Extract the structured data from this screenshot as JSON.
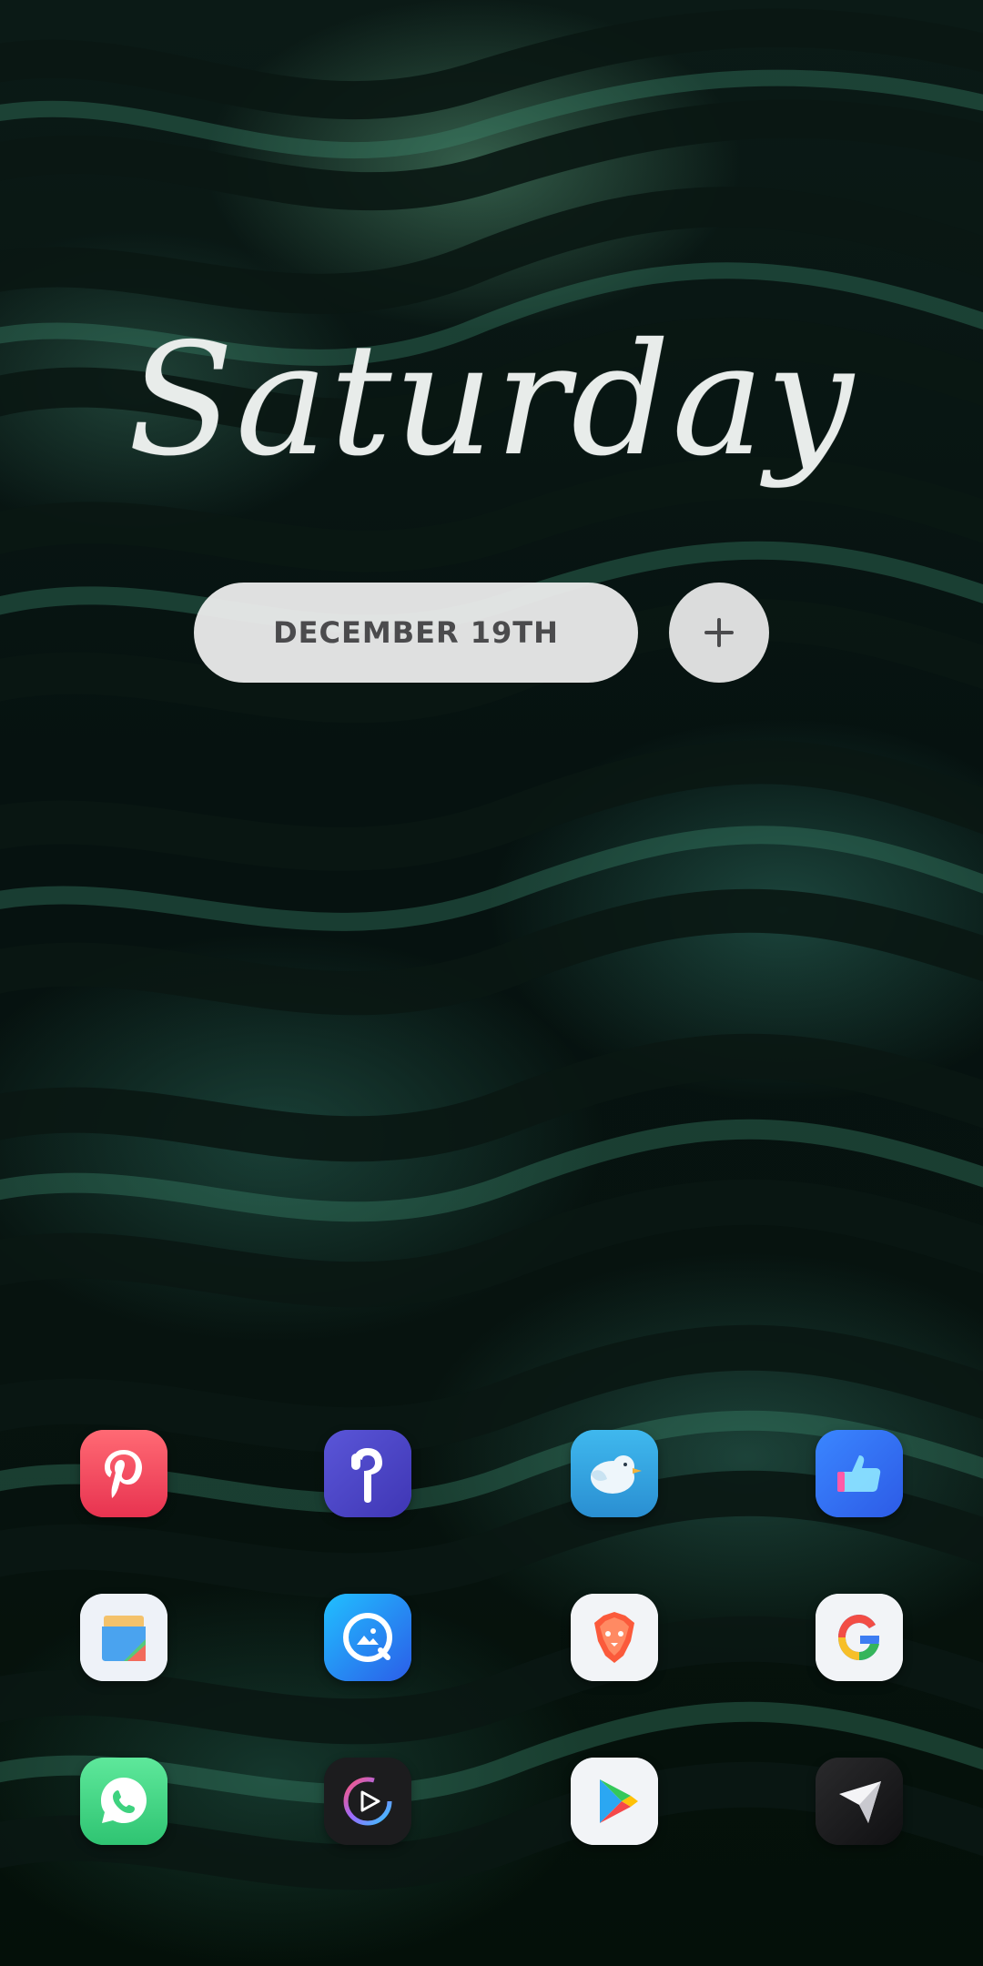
{
  "widget": {
    "day": "Saturday",
    "date": "December 19th",
    "add_icon": "plus-icon"
  },
  "dock": {
    "rows": [
      [
        {
          "app": "Pinterest",
          "icon": "pinterest-icon",
          "color": "#f0465a"
        },
        {
          "app": "Earbuds",
          "icon": "earbuds-icon",
          "color": "#4d48c9"
        },
        {
          "app": "Bird",
          "icon": "bird-icon",
          "color": "#2ba6e0"
        },
        {
          "app": "Thumbs Up",
          "icon": "thumbs-up-icon",
          "color": "#2f6ff2"
        }
      ],
      [
        {
          "app": "Files",
          "icon": "files-icon",
          "color": "#eef2f8"
        },
        {
          "app": "Gallery",
          "icon": "gallery-icon",
          "color": "#2a8cf5"
        },
        {
          "app": "Brave",
          "icon": "brave-lion-icon",
          "color": "#f2f4f7"
        },
        {
          "app": "Google",
          "icon": "google-g-icon",
          "color": "#f2f4f7"
        }
      ],
      [
        {
          "app": "WhatsApp",
          "icon": "whatsapp-icon",
          "color": "#3ed27f"
        },
        {
          "app": "Media Player",
          "icon": "media-player-icon",
          "color": "#1c1c1e"
        },
        {
          "app": "Play Store",
          "icon": "play-store-icon",
          "color": "#f2f4f7"
        },
        {
          "app": "Send",
          "icon": "paper-plane-icon",
          "color": "#1e1e20"
        }
      ]
    ]
  }
}
